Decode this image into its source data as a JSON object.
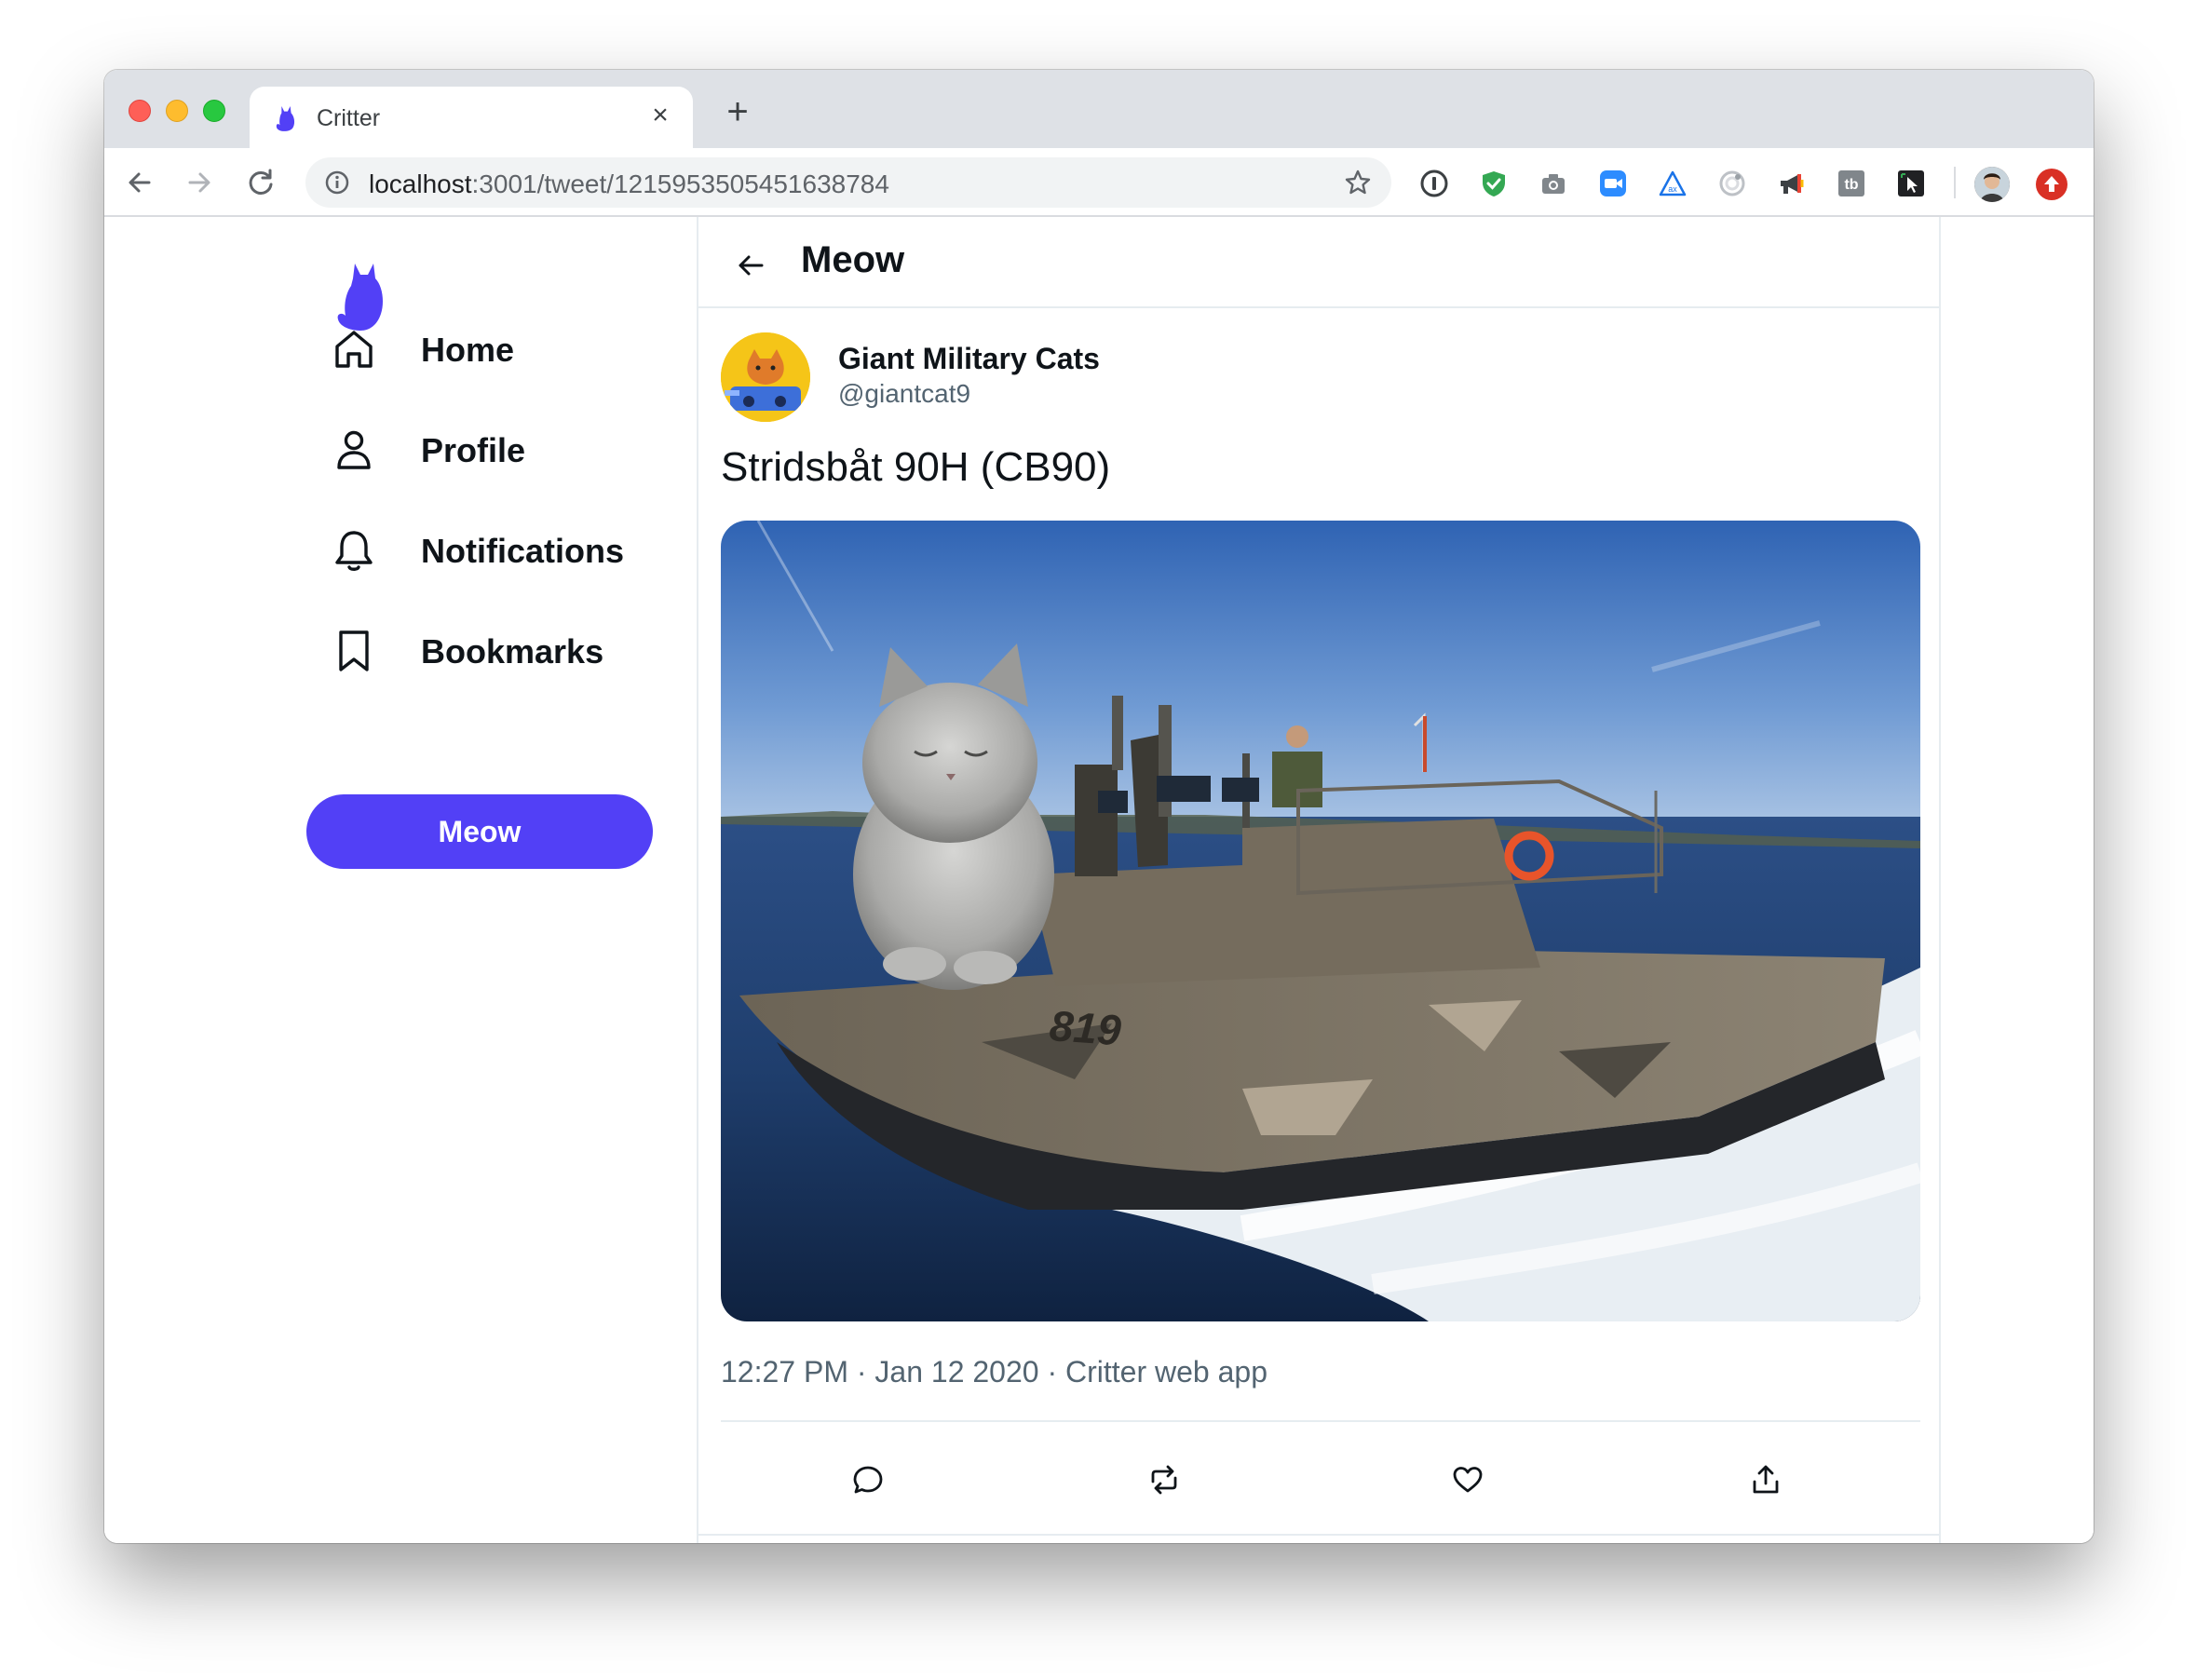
{
  "browser": {
    "tab_title": "Critter",
    "tab_close": "×",
    "new_tab": "+",
    "url_host": "localhost",
    "url_path": ":3001/tweet/1215953505451638784",
    "extensions": [
      "1password-icon",
      "shield-check-icon",
      "camera-icon",
      "zoom-icon",
      "triangle-ax-icon",
      "color-picker-icon",
      "megaphone-icon",
      "tb-icon",
      "cursor-icon"
    ]
  },
  "sidebar": {
    "items": [
      {
        "label": "Home",
        "icon": "home-icon"
      },
      {
        "label": "Profile",
        "icon": "profile-icon"
      },
      {
        "label": "Notifications",
        "icon": "bell-icon"
      },
      {
        "label": "Bookmarks",
        "icon": "bookmark-icon"
      }
    ],
    "meow_button": "Meow"
  },
  "main": {
    "title": "Meow",
    "tweet": {
      "display_name": "Giant Military Cats",
      "handle": "@giantcat9",
      "text": "Stridsbåt 90H (CB90)",
      "boat_number": "819",
      "timestamp": "12:27 PM · Jan 12 2020 · Critter web app"
    },
    "actions": [
      "reply-icon",
      "retweet-icon",
      "like-icon",
      "share-icon"
    ]
  },
  "colors": {
    "brand": "#5240f6",
    "text": "#0f1419",
    "muted": "#536471"
  }
}
